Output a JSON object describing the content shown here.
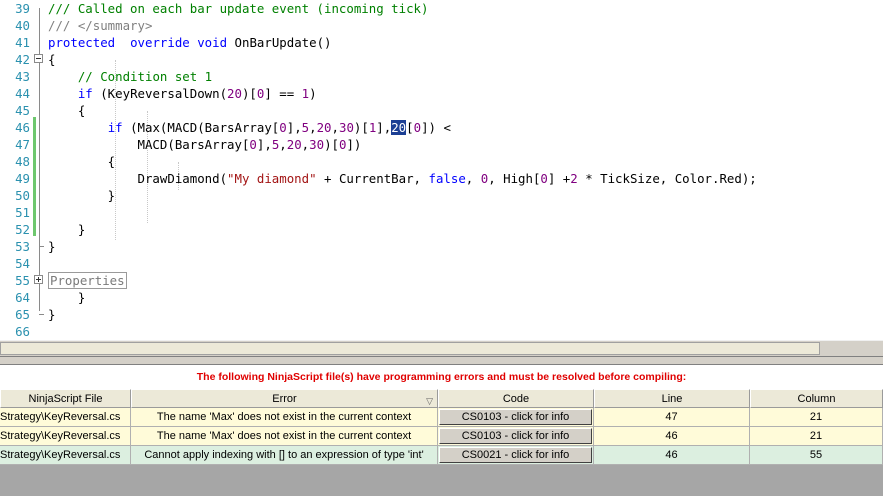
{
  "editor": {
    "lines": [
      {
        "num": "39",
        "tokens": [
          [
            "cm",
            "/// Called on each bar update event (incoming tick)"
          ]
        ]
      },
      {
        "num": "40",
        "tokens": [
          [
            "xd",
            "/// </summary>"
          ]
        ]
      },
      {
        "num": "41",
        "tokens": [
          [
            "kw",
            "protected"
          ],
          [
            "",
            "  "
          ],
          [
            "kw",
            "override"
          ],
          [
            "",
            " "
          ],
          [
            "kw",
            "void"
          ],
          [
            "",
            " OnBarUpdate()"
          ]
        ]
      },
      {
        "num": "42",
        "tokens": [
          [
            "",
            "{"
          ]
        ]
      },
      {
        "num": "43",
        "tokens": [
          [
            "",
            "    "
          ],
          [
            "cm",
            "// Condition set 1"
          ]
        ]
      },
      {
        "num": "44",
        "tokens": [
          [
            "",
            "    "
          ],
          [
            "kw",
            "if"
          ],
          [
            "",
            " (KeyReversalDown("
          ],
          [
            "num",
            "20"
          ],
          [
            "",
            ")["
          ],
          [
            "num",
            "0"
          ],
          [
            "",
            "] == "
          ],
          [
            "num",
            "1"
          ],
          [
            "",
            ")"
          ]
        ]
      },
      {
        "num": "45",
        "tokens": [
          [
            "",
            "    {"
          ]
        ]
      },
      {
        "num": "46",
        "tokens": [
          [
            "",
            "        "
          ],
          [
            "kw",
            "if"
          ],
          [
            "",
            " (Max(MACD(BarsArray["
          ],
          [
            "num",
            "0"
          ],
          [
            "",
            "],"
          ],
          [
            "num",
            "5"
          ],
          [
            "",
            ","
          ],
          [
            "num",
            "20"
          ],
          [
            "",
            ","
          ],
          [
            "num",
            "30"
          ],
          [
            "",
            ")["
          ],
          [
            "num",
            "1"
          ],
          [
            "",
            "],"
          ],
          [
            "sel",
            "20"
          ],
          [
            "",
            "["
          ],
          [
            "num",
            "0"
          ],
          [
            "",
            "]) <"
          ]
        ]
      },
      {
        "num": "47",
        "tokens": [
          [
            "",
            "            MACD(BarsArray["
          ],
          [
            "num",
            "0"
          ],
          [
            "",
            "],"
          ],
          [
            "num",
            "5"
          ],
          [
            "",
            ","
          ],
          [
            "num",
            "20"
          ],
          [
            "",
            ","
          ],
          [
            "num",
            "30"
          ],
          [
            "",
            ")["
          ],
          [
            "num",
            "0"
          ],
          [
            "",
            "])"
          ]
        ]
      },
      {
        "num": "48",
        "tokens": [
          [
            "",
            "        {"
          ]
        ]
      },
      {
        "num": "49",
        "tokens": [
          [
            "",
            "            DrawDiamond("
          ],
          [
            "str",
            "\"My diamond\""
          ],
          [
            "",
            " + CurrentBar, "
          ],
          [
            "kw",
            "false"
          ],
          [
            "",
            ", "
          ],
          [
            "num",
            "0"
          ],
          [
            "",
            ", High["
          ],
          [
            "num",
            "0"
          ],
          [
            "",
            "] +"
          ],
          [
            "num",
            "2"
          ],
          [
            "",
            " * TickSize, Color.Red);"
          ]
        ]
      },
      {
        "num": "50",
        "tokens": [
          [
            "",
            "        }"
          ]
        ]
      },
      {
        "num": "51",
        "tokens": [
          [
            "",
            ""
          ]
        ]
      },
      {
        "num": "52",
        "tokens": [
          [
            "",
            "    }"
          ]
        ]
      },
      {
        "num": "53",
        "tokens": [
          [
            "",
            "}"
          ]
        ]
      },
      {
        "num": "54",
        "tokens": [
          [
            "",
            ""
          ]
        ]
      },
      {
        "num": "55",
        "tokens": [
          [
            "region",
            "Properties"
          ]
        ]
      },
      {
        "num": "64",
        "tokens": [
          [
            "",
            "    }"
          ]
        ]
      },
      {
        "num": "65",
        "tokens": [
          [
            "",
            "}"
          ]
        ]
      },
      {
        "num": "66",
        "tokens": [
          [
            "",
            ""
          ]
        ]
      }
    ]
  },
  "errors": {
    "title": "The following NinjaScript file(s) have programming errors and must be resolved before compiling:",
    "columns": {
      "file": "NinjaScript File",
      "error": "Error",
      "code": "Code",
      "line": "Line",
      "column": "Column"
    },
    "rows": [
      {
        "file": "Strategy\\KeyReversal.cs",
        "error": "The name 'Max' does not exist in the current context",
        "code": "CS0103 - click for info",
        "line": "47",
        "column": "21",
        "status": "yellow"
      },
      {
        "file": "Strategy\\KeyReversal.cs",
        "error": "The name 'Max' does not exist in the current context",
        "code": "CS0103 - click for info",
        "line": "46",
        "column": "21",
        "status": "yellow"
      },
      {
        "file": "Strategy\\KeyReversal.cs",
        "error": "Cannot apply indexing with [] to an expression of type 'int'",
        "code": "CS0021 - click for info",
        "line": "46",
        "column": "55",
        "status": "green"
      }
    ]
  },
  "colors": {
    "error_title": "#e00000",
    "row_warning": "#fffbd9",
    "row_ok": "#dcefe0",
    "keyword": "#0000ff",
    "comment": "#008000",
    "line_number": "#2b91af"
  }
}
